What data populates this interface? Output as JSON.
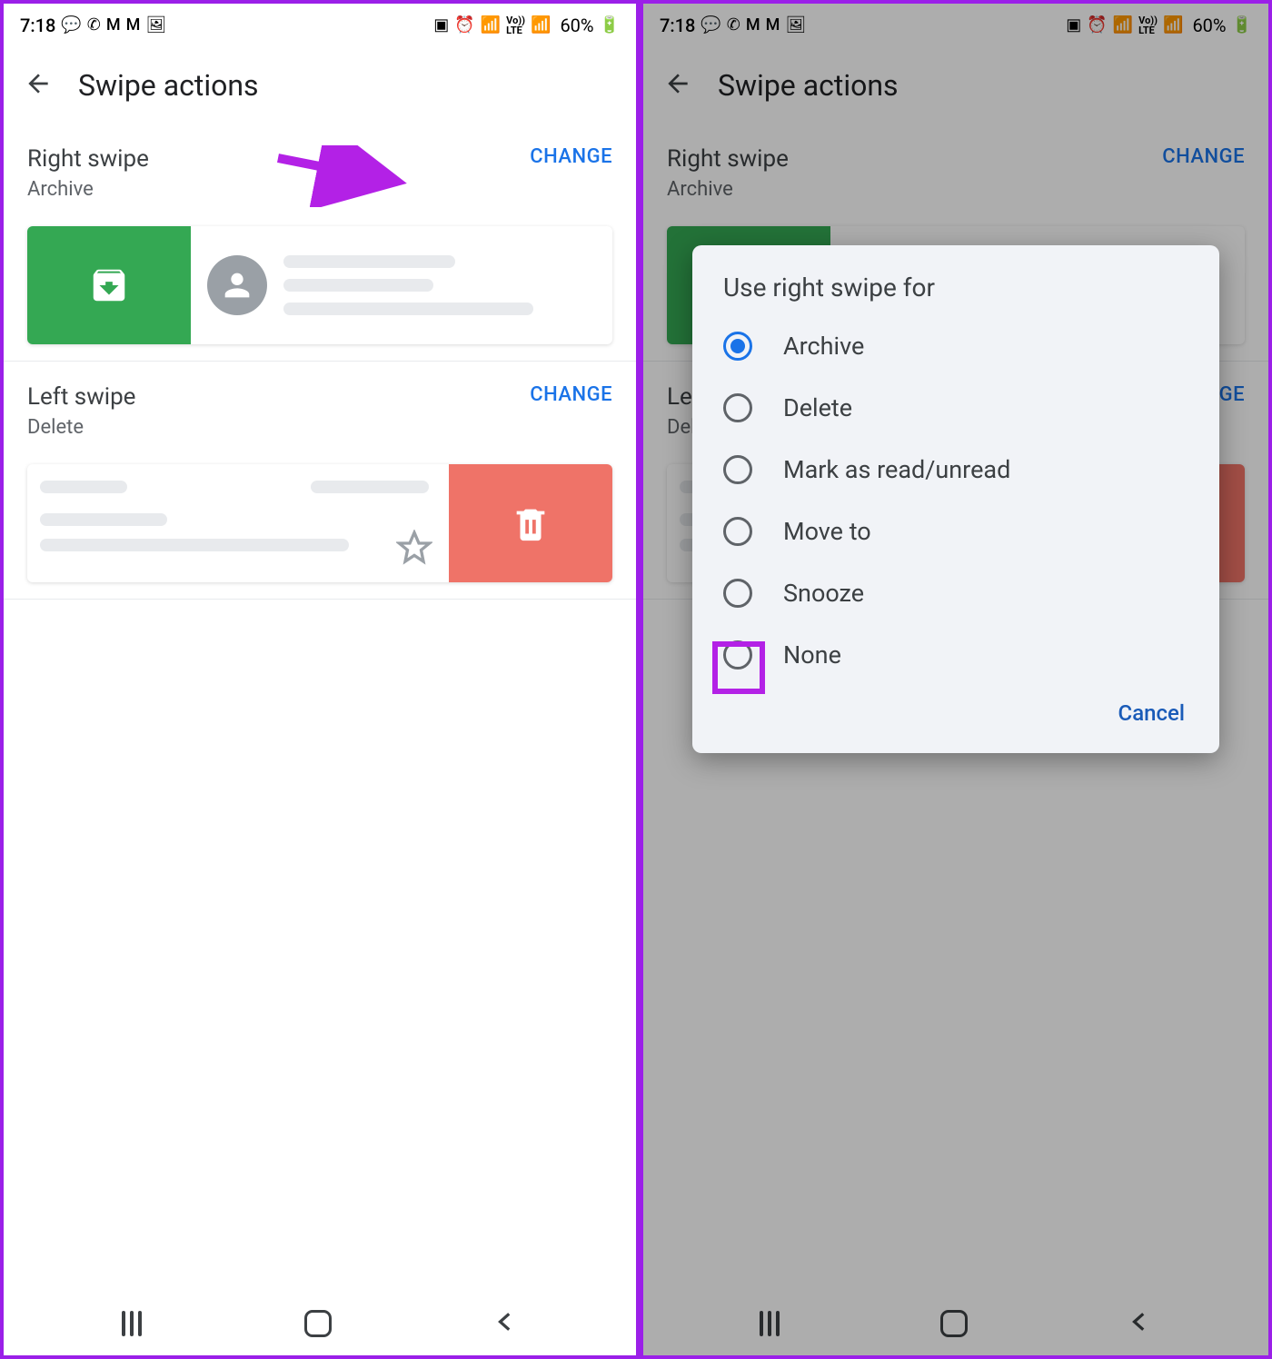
{
  "status": {
    "time": "7:18",
    "battery": "60%"
  },
  "appbar_title": "Swipe actions",
  "right_swipe": {
    "heading": "Right swipe",
    "action": "Archive",
    "change": "CHANGE"
  },
  "left_swipe": {
    "heading": "Left swipe",
    "action": "Delete",
    "change": "CHANGE"
  },
  "dialog": {
    "title": "Use right swipe for",
    "options": [
      {
        "label": "Archive",
        "selected": true
      },
      {
        "label": "Delete",
        "selected": false
      },
      {
        "label": "Mark as read/unread",
        "selected": false
      },
      {
        "label": "Move to",
        "selected": false
      },
      {
        "label": "Snooze",
        "selected": false
      },
      {
        "label": "None",
        "selected": false
      }
    ],
    "cancel": "Cancel"
  }
}
